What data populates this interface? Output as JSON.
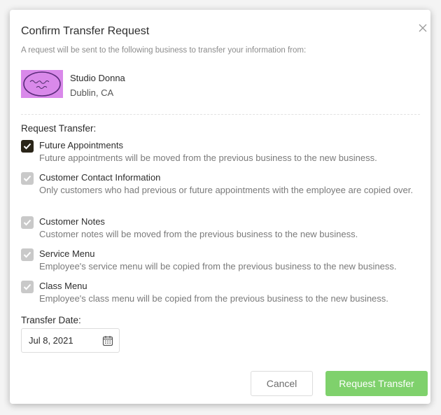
{
  "dialog": {
    "title": "Confirm Transfer Request",
    "subtitle": "A request will be sent to the following business to transfer your information from:"
  },
  "business": {
    "name": "Studio Donna",
    "location": "Dublin, CA",
    "logo_text": "Studio Donna",
    "logo_color": "#d989ea"
  },
  "request_transfer": {
    "label": "Request Transfer:",
    "options": [
      {
        "title": "Future Appointments",
        "description": "Future appointments will be moved from the previous business to the new business.",
        "checked": true,
        "enabled": true
      },
      {
        "title": "Customer Contact Information",
        "description": "Only customers who had previous or future appointments with the employee are copied over.",
        "checked": true,
        "enabled": false
      },
      {
        "title": "Customer Notes",
        "description": "Customer notes will be moved from the previous business to the new business.",
        "checked": true,
        "enabled": false
      },
      {
        "title": "Service Menu",
        "description": "Employee's service menu will be copied from the previous business to the new business.",
        "checked": true,
        "enabled": false
      },
      {
        "title": "Class Menu",
        "description": "Employee's class menu will be copied from the previous business to the new business.",
        "checked": true,
        "enabled": false
      }
    ]
  },
  "transfer_date": {
    "label": "Transfer Date:",
    "value": "Jul 8, 2021",
    "icon": "calendar-icon"
  },
  "buttons": {
    "cancel": "Cancel",
    "submit": "Request Transfer"
  },
  "colors": {
    "primary": "#7fd16c",
    "checkbox_checked": "#2a2518",
    "checkbox_disabled": "#c9c9c9"
  }
}
